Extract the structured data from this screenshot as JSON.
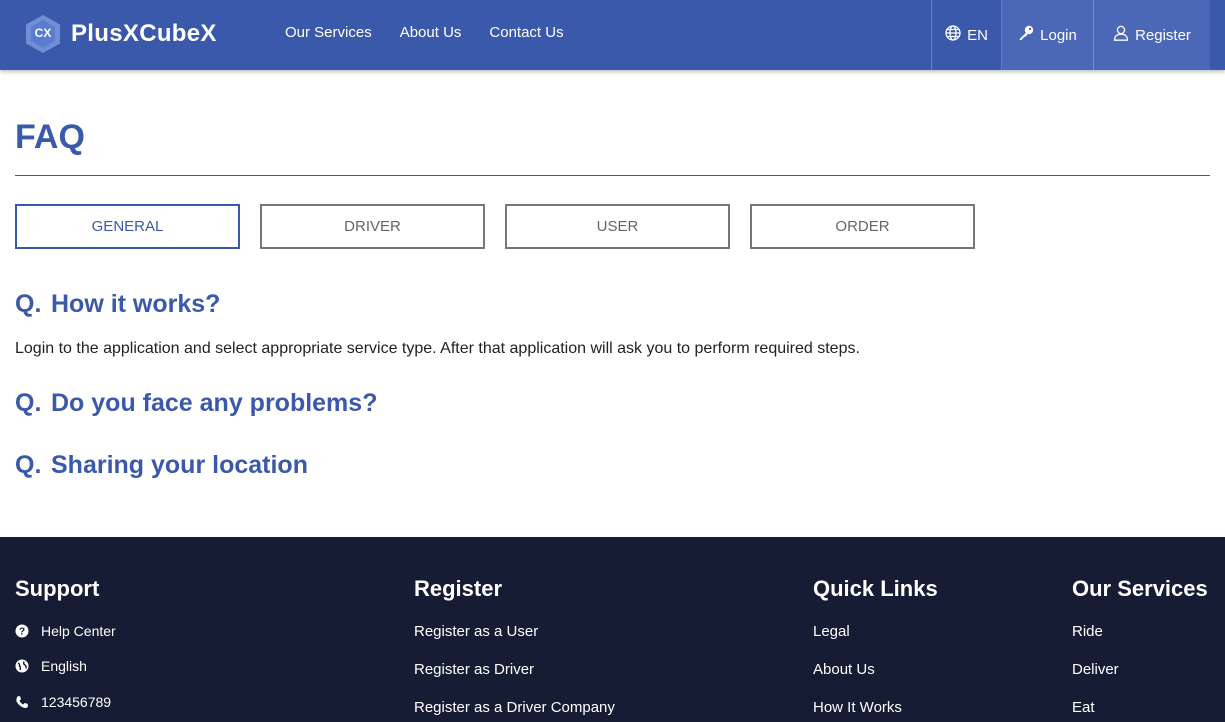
{
  "header": {
    "logo_badge": "CX",
    "logo_text": "PlusXCubeX",
    "nav": [
      "Our Services",
      "About Us",
      "Contact Us"
    ],
    "language": "EN",
    "login": "Login",
    "register": "Register"
  },
  "main": {
    "title": "FAQ",
    "tabs": [
      "GENERAL",
      "DRIVER",
      "USER",
      "ORDER"
    ],
    "active_tab": "GENERAL",
    "question_prefix": "Q.",
    "faqs": [
      {
        "question": "How it works?",
        "answer": "Login to the application and select appropriate service type. After that application will ask you to perform required steps."
      },
      {
        "question": "Do you face any problems?"
      },
      {
        "question": "Sharing your location"
      }
    ]
  },
  "footer": {
    "support": {
      "heading": "Support",
      "items": [
        {
          "icon": "question-circle-icon",
          "label": "Help Center"
        },
        {
          "icon": "globe-icon",
          "label": "English"
        },
        {
          "icon": "phone-icon",
          "label": "123456789"
        }
      ]
    },
    "register": {
      "heading": "Register",
      "links": [
        "Register as a User",
        "Register as Driver",
        "Register as a Driver Company"
      ]
    },
    "quick_links": {
      "heading": "Quick Links",
      "links": [
        "Legal",
        "About Us",
        "How It Works"
      ]
    },
    "services": {
      "heading": "Our Services",
      "links": [
        "Ride",
        "Deliver",
        "Eat"
      ]
    }
  },
  "colors": {
    "brand": "#3a59ab",
    "footer_bg": "#151c34"
  }
}
